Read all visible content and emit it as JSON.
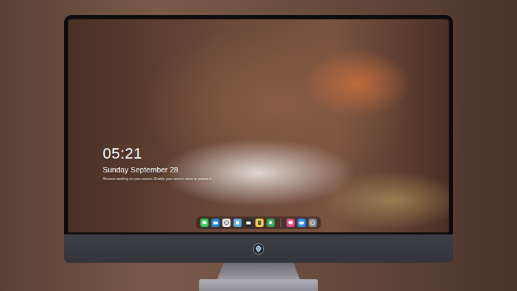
{
  "desktop": {
    "clock": "05:21",
    "date": "Sunday September 28",
    "note": "Resume working on your screen. Enable your screen saver to protect it..."
  },
  "dock": {
    "groups": [
      {
        "apps": [
          {
            "color": "#34c759"
          },
          {
            "color": "#1e88e5"
          },
          {
            "color": "#e6e6e6"
          },
          {
            "color": "#5ab0e6"
          },
          {
            "color": "#2b2b2b"
          },
          {
            "color": "#f5d04a"
          },
          {
            "color": "#3aa55a"
          }
        ]
      },
      {
        "apps": [
          {
            "color": "#e0508a"
          },
          {
            "color": "#2f8ff0"
          },
          {
            "color": "#8a8a90"
          }
        ]
      }
    ]
  }
}
